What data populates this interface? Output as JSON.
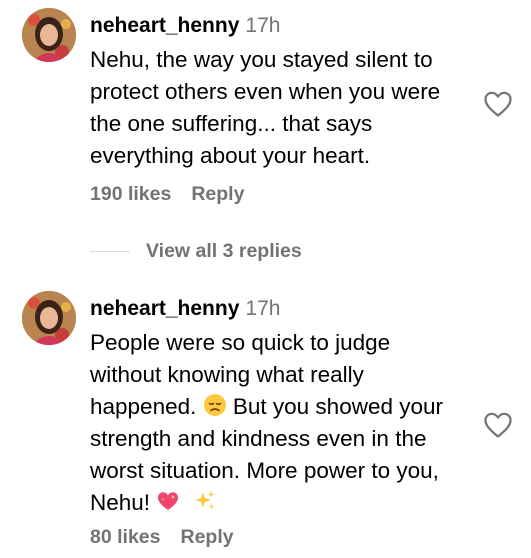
{
  "comments": [
    {
      "username": "neheart_henny",
      "timestamp": "17h",
      "text": "Nehu, the way you stayed silent to\nprotect others even when you were\nthe one suffering... that says\neverything about your heart.",
      "likes": "190 likes",
      "reply_label": "Reply",
      "view_replies": "View all 3 replies",
      "like_icon": "heart-outline-icon"
    },
    {
      "username": "neheart_henny",
      "timestamp": "17h",
      "text_part1": "People were so quick to judge\nwithout knowing what really\nhappened. ",
      "emoji1": "disappointed-face",
      "text_part2": " But you showed your\nstrength and kindness even in the\nworst situation. More power to you,\nNehu! ",
      "emoji2": "sparkling-heart",
      "emoji3": "sparkles",
      "likes": "80 likes",
      "reply_label": "Reply",
      "like_icon": "heart-outline-icon"
    }
  ],
  "colors": {
    "text": "#000000",
    "secondary": "#737373",
    "divider": "#dbdbdb",
    "background": "#ffffff"
  }
}
